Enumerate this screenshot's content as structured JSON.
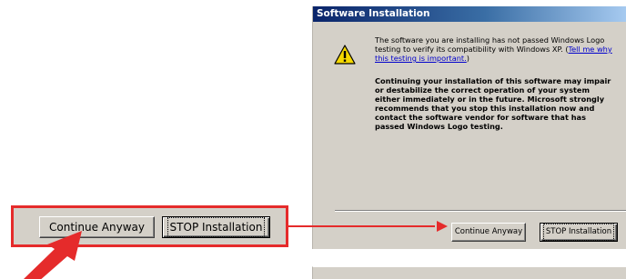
{
  "dialog": {
    "title": "Software Installation",
    "message_line": "The software you are installing has not passed Windows Logo testing to verify its compatibility with Windows XP.",
    "link_text": "Tell me why this testing is important.",
    "warning": "Continuing your installation of this software may impair or destabilize the correct operation of your system either immediately or in the future. Microsoft strongly recommends that you stop this installation now and contact the software vendor for software that has passed Windows Logo testing.",
    "icon": "warning-icon",
    "continue_label": "Continue Anyway",
    "stop_label": "STOP Installation"
  },
  "callout": {
    "continue_label": "Continue Anyway",
    "stop_label": "STOP Installation",
    "highlight_color": "#e52b2b"
  },
  "colors": {
    "dialog_bg": "#d4d0c8",
    "titlebar_start": "#0a246a",
    "titlebar_end": "#a6caf0",
    "arrow": "#e52b2b",
    "link": "#0000cc"
  }
}
